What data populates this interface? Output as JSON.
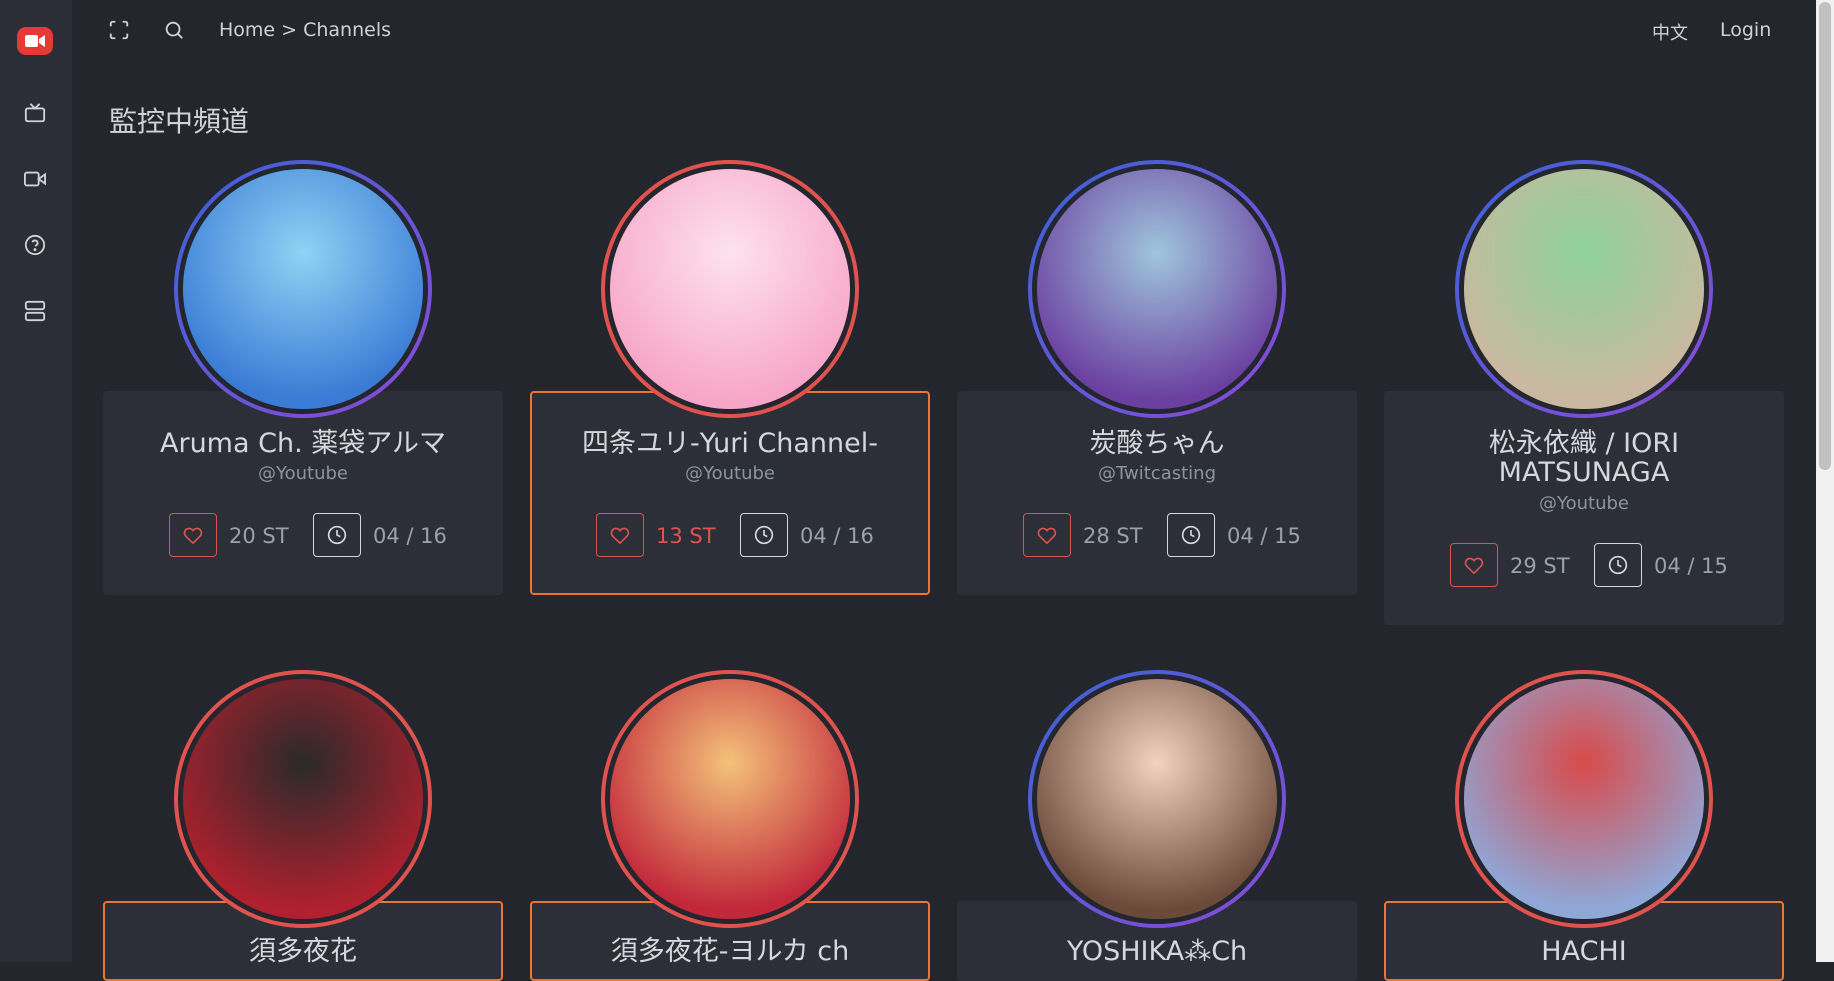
{
  "app": {
    "logo_icon": "video-camera-icon",
    "accent": "#e53935"
  },
  "sidebar": {
    "items": [
      {
        "icon": "tv-icon"
      },
      {
        "icon": "video-icon"
      },
      {
        "icon": "help-circle-icon"
      },
      {
        "icon": "server-icon"
      }
    ]
  },
  "topbar": {
    "fullscreen_icon": "fullscreen-icon",
    "search_icon": "search-icon",
    "breadcrumb": "Home > Channels",
    "language": "中文",
    "login": "Login"
  },
  "page": {
    "title": "監控中頻道"
  },
  "channels": [
    {
      "name": "Aruma Ch. 薬袋アルマ",
      "platform": "@Youtube",
      "streams": "20 ST",
      "date": "04 / 16",
      "ring": "blue",
      "active": false
    },
    {
      "name": "四条ユリ-Yuri Channel-",
      "platform": "@Youtube",
      "streams": "13 ST",
      "date": "04 / 16",
      "ring": "red",
      "active": true
    },
    {
      "name": "炭酸ちゃん",
      "platform": "@Twitcasting",
      "streams": "28 ST",
      "date": "04 / 15",
      "ring": "blue",
      "active": false
    },
    {
      "name": "松永依織 / IORI MATSUNAGA",
      "platform": "@Youtube",
      "streams": "29 ST",
      "date": "04 / 15",
      "ring": "blue",
      "active": false
    },
    {
      "name": "須多夜花",
      "ring": "red",
      "active": true
    },
    {
      "name": "須多夜花-ヨルカ ch",
      "ring": "red",
      "active": true
    },
    {
      "name": "YOSHIKA⁂Ch",
      "ring": "blue",
      "active": false
    },
    {
      "name": "HACHI",
      "ring": "red",
      "active": true
    }
  ]
}
